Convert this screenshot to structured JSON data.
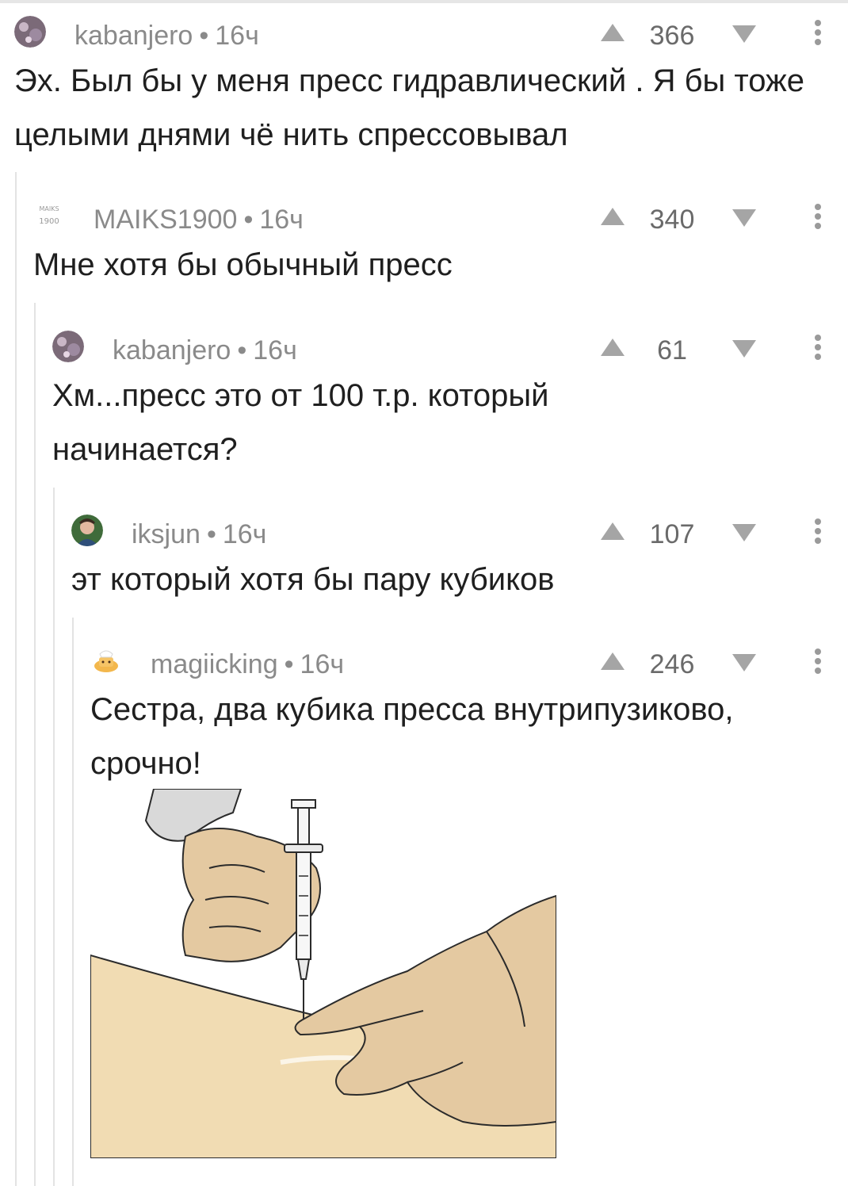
{
  "separator": "•",
  "comments": [
    {
      "author": "kabanjero",
      "time": "16ч",
      "votes": "366",
      "text": "Эх. Был бы у меня пресс гидравлический . Я бы тоже целыми днями чё нить спрессовывал",
      "avatar": "kabanjero-avatar"
    },
    {
      "author": "MAIKS1900",
      "time": "16ч",
      "votes": "340",
      "text": "Мне хотя бы обычный пресс",
      "avatar": "maiks-avatar"
    },
    {
      "author": "kabanjero",
      "time": "16ч",
      "votes": "61",
      "text": "Хм...пресс это от 100 т.р. который начинается?",
      "avatar": "kabanjero-avatar"
    },
    {
      "author": "iksjun",
      "time": "16ч",
      "votes": "107",
      "text": "эт который хотя бы пару кубиков",
      "avatar": "iksjun-avatar"
    },
    {
      "author": "magiicking",
      "time": "16ч",
      "votes": "246",
      "text": "Сестра, два кубика пресса внутрипузиково, срочно!",
      "avatar": "magiicking-avatar"
    }
  ],
  "attachment": {
    "icon": "injection-illustration",
    "colors": {
      "skin": "#f1dcb3",
      "glove": "#e4c9a1",
      "outline": "#2b2b2b"
    }
  },
  "colors": {
    "meta": "#8a8a8a",
    "text": "#1f1f1f",
    "thread_line": "#e3e3e3",
    "vote_icon": "#a5a5a5"
  }
}
